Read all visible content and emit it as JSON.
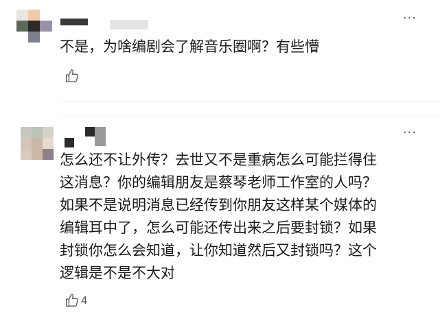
{
  "comments": [
    {
      "text": "不是，为啥编剧会了解音乐圈啊？有些懵",
      "more_label": "···",
      "like_icon": "thumbs-up-icon",
      "like_count": ""
    },
    {
      "text": "怎么还不让外传？去世又不是重病怎么可能拦得住\n这消息？你的编辑朋友是蔡琴老师工作室的人吗？\n如果不是说明消息已经传到你朋友这样某个媒体的\n编辑耳中了，怎么可能还传出来之后要封锁？如果\n封锁你怎么会知道，让你知道然后又封锁吗？这个\n逻辑是不是不大对",
      "more_label": "···",
      "like_icon": "thumbs-up-icon",
      "like_count": "4"
    }
  ],
  "colors": {
    "divider": "#ececec",
    "icon": "#666666"
  }
}
